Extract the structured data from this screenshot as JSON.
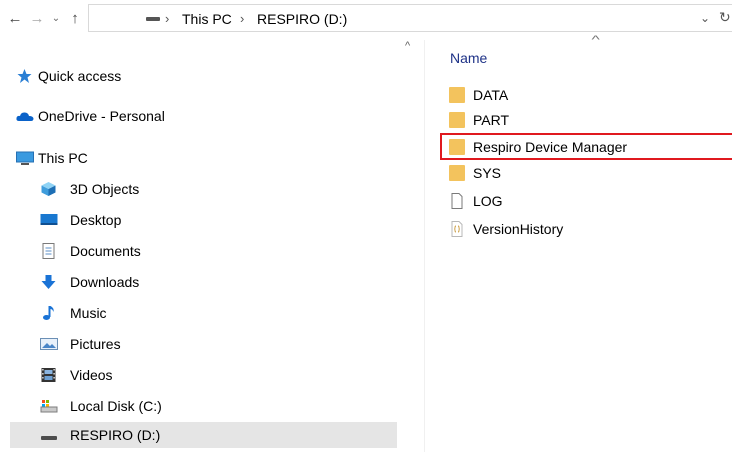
{
  "address_bar": {
    "back_glyph": "←",
    "forward_glyph": "→",
    "recent_glyph": "⌄",
    "up_glyph": "↑",
    "breadcrumb": [
      "This PC",
      "RESPIRO (D:)"
    ],
    "separator": "›",
    "dropdown_glyph": "⌄",
    "refresh_glyph": "↻"
  },
  "nav": {
    "items": [
      {
        "label": "Quick access",
        "icon": "star-icon"
      },
      {
        "label": "OneDrive - Personal",
        "icon": "cloud-icon"
      },
      {
        "label": "This PC",
        "icon": "monitor-icon"
      },
      {
        "label": "3D Objects",
        "icon": "cube-icon"
      },
      {
        "label": "Desktop",
        "icon": "desktop-icon"
      },
      {
        "label": "Documents",
        "icon": "documents-icon"
      },
      {
        "label": "Downloads",
        "icon": "download-arrow-icon"
      },
      {
        "label": "Music",
        "icon": "music-note-icon"
      },
      {
        "label": "Pictures",
        "icon": "pictures-icon"
      },
      {
        "label": "Videos",
        "icon": "film-icon"
      },
      {
        "label": "Local Disk (C:)",
        "icon": "local-disk-icon"
      },
      {
        "label": "RESPIRO (D:)",
        "icon": "drive-icon",
        "selected": true
      }
    ],
    "scroll_up_glyph": "^"
  },
  "content": {
    "sort_glyph": "^",
    "column_name": "Name",
    "files": [
      {
        "name": "DATA",
        "type": "folder"
      },
      {
        "name": "PART",
        "type": "folder"
      },
      {
        "name": "Respiro Device Manager",
        "type": "folder",
        "highlighted": true
      },
      {
        "name": "SYS",
        "type": "folder"
      },
      {
        "name": "LOG",
        "type": "file"
      },
      {
        "name": "VersionHistory",
        "type": "text-file"
      }
    ]
  },
  "colors": {
    "folder": "#f3c35d",
    "selected_bg": "#e5e5e5",
    "highlight_border": "#e0191f",
    "column_header": "#1e3287"
  }
}
